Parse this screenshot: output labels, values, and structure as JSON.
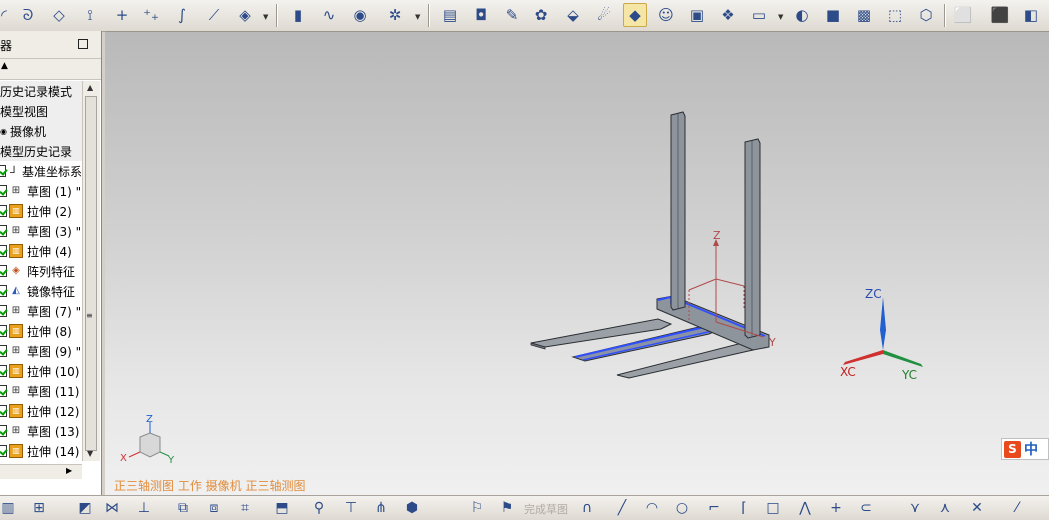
{
  "toolbar": {
    "icons": [
      "fillet-icon",
      "sketch-curve-icon",
      "plane-icon",
      "dimension-icon",
      "point-icon",
      "point-set-icon",
      "offset-curve-icon",
      "surface-icon",
      "move-face-icon",
      "cylinder-icon",
      "spring-icon",
      "thread-icon",
      "weld-icon",
      "render-icon",
      "camera-icon",
      "paint-icon",
      "color-palette-icon",
      "material-icon",
      "light-icon",
      "active-light-icon",
      "user-icon",
      "portrait-icon",
      "scene-icon",
      "screen-icon",
      "camera2-icon",
      "cube-icon",
      "texture-icon",
      "box-shade-icon",
      "wire-box-icon",
      "snap-view-icon",
      "part-icon",
      "part-blue-icon"
    ]
  },
  "navigator": {
    "title": "器",
    "items": [
      {
        "label": "历史记录模式",
        "type": "section"
      },
      {
        "label": "模型视图",
        "type": "section"
      },
      {
        "label": "摄像机",
        "type": "section"
      },
      {
        "label": "模型历史记录",
        "type": "section"
      },
      {
        "label": "基准坐标系",
        "type": "csys"
      },
      {
        "label": "草图 (1) \"",
        "type": "sketch"
      },
      {
        "label": "拉伸 (2)",
        "type": "extrude"
      },
      {
        "label": "草图 (3) \"",
        "type": "sketch"
      },
      {
        "label": "拉伸 (4)",
        "type": "extrude"
      },
      {
        "label": "阵列特征",
        "type": "pattern"
      },
      {
        "label": "镜像特征",
        "type": "mirror"
      },
      {
        "label": "草图 (7) \"",
        "type": "sketch"
      },
      {
        "label": "拉伸 (8)",
        "type": "extrude"
      },
      {
        "label": "草图 (9) \"",
        "type": "sketch"
      },
      {
        "label": "拉伸 (10)",
        "type": "extrude"
      },
      {
        "label": "草图 (11)",
        "type": "sketch"
      },
      {
        "label": "拉伸 (12)",
        "type": "extrude"
      },
      {
        "label": "草图 (13)",
        "type": "sketch"
      },
      {
        "label": "拉伸 (14)",
        "type": "extrude"
      }
    ]
  },
  "viewport": {
    "caption": "正三轴测图 工作 摄像机 正三轴测图",
    "csys_labels": {
      "z": "Z",
      "y": "Y"
    },
    "wcs_labels": {
      "zc": "ZC",
      "xc": "XC",
      "yc": "YC"
    },
    "triad_labels": {
      "z": "Z",
      "x": "X",
      "y": "Y"
    },
    "ime": {
      "brand": "S",
      "lang": "中"
    }
  },
  "bottombar": {
    "finish_sketch_label": "完成草图"
  },
  "colors": {
    "caption": "#e08d3b",
    "xc_axis": "#d03030",
    "yc_axis": "#209040",
    "zc_axis": "#2060d0",
    "selection_blue": "#3050ff",
    "model": "#8a9098"
  }
}
